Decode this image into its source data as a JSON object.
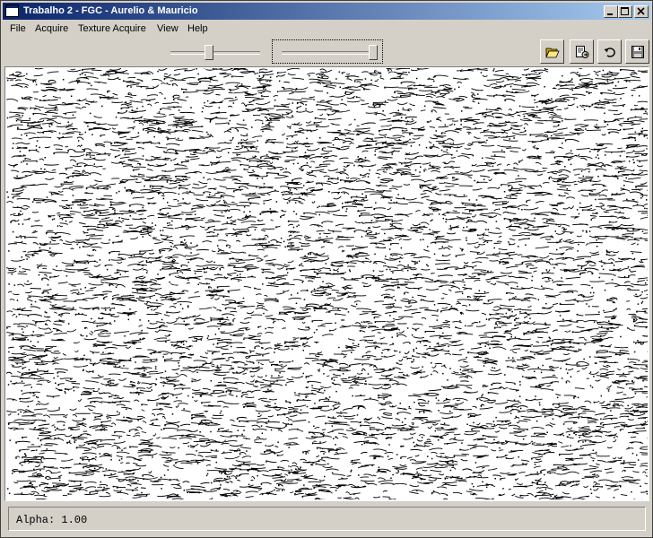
{
  "window": {
    "title": "Trabalho 2 - FGC - Aurelio & Mauricio",
    "icon": "app-window-icon"
  },
  "title_buttons": [
    {
      "name": "minimize-button",
      "icon": "minimize-icon"
    },
    {
      "name": "maximize-button",
      "icon": "maximize-icon"
    },
    {
      "name": "close-button",
      "icon": "close-icon"
    }
  ],
  "menu": {
    "file": "File",
    "acquire": "Acquire",
    "texture_acquire": "Texture Acquire",
    "view": "View",
    "help": "Help"
  },
  "toolbar": {
    "slider_1_level": 0.42,
    "slider_2_level": 0.96,
    "buttons": [
      {
        "name": "open-button",
        "icon": "open-folder-icon"
      },
      {
        "name": "export-button",
        "icon": "export-document-icon"
      },
      {
        "name": "undo-button",
        "icon": "undo-icon"
      },
      {
        "name": "save-button",
        "icon": "save-disk-icon"
      }
    ]
  },
  "image": {
    "description_icon": "edge-detected-texture-image"
  },
  "status": {
    "text": "Alpha: 1.00"
  }
}
